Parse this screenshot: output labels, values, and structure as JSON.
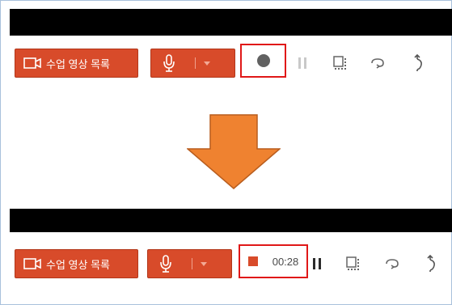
{
  "toolbar": {
    "list_button_label": "수업 영상 목록",
    "timer": "00:28"
  },
  "icons": {
    "video": "video-camera-icon",
    "mic": "microphone-icon",
    "dropdown": "caret-down-icon",
    "record": "record-dot-icon",
    "stop": "stop-square-icon",
    "pause": "pause-icon",
    "screen": "screen-capture-icon",
    "undo": "undo-icon",
    "pointer": "pointer-icon",
    "arrow": "down-arrow-icon"
  },
  "colors": {
    "accent": "#d84b2a",
    "highlight": "#e01818",
    "arrow": "#ef8230"
  }
}
